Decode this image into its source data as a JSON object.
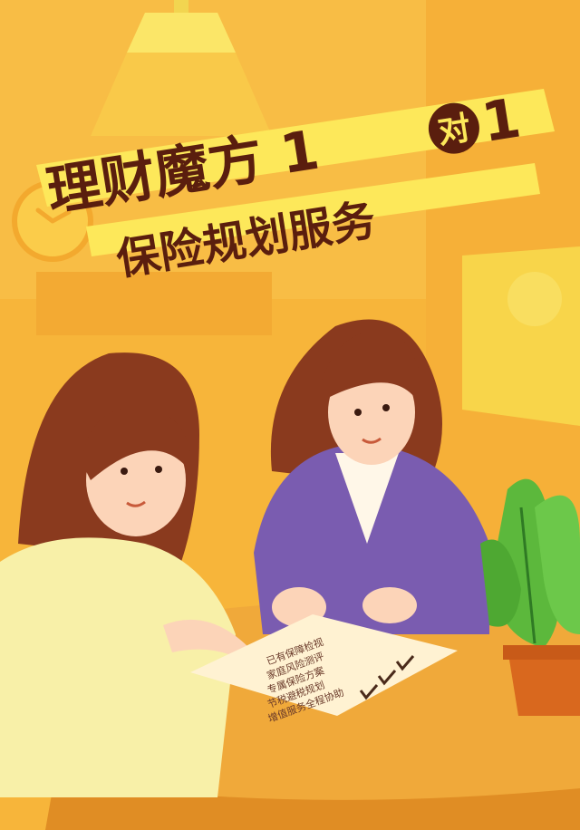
{
  "banner": {
    "title_main": "理财魔方 1",
    "title_circle": "对",
    "title_end": "1",
    "subtitle": "保险规划服务"
  },
  "document": {
    "lines": [
      "已有保障检视",
      "家庭风险测评",
      "专属保险方案",
      "节税避税规划",
      "增值服务全程协助"
    ]
  },
  "colors": {
    "background": "#f7b53a",
    "banner_yellow": "#fde85a",
    "title_brown": "#5a1e0e",
    "jacket_purple": "#7a5cb0",
    "plant_green": "#5cb83c",
    "pot_orange": "#d9681e"
  }
}
